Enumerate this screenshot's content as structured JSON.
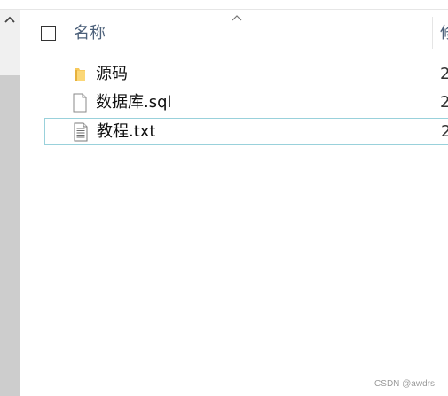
{
  "header": {
    "name_label": "名称",
    "next_column_label": "修"
  },
  "files": [
    {
      "name": "源码",
      "icon": "folder-icon",
      "date": "2"
    },
    {
      "name": "数据库.sql",
      "icon": "blank-file-icon",
      "date": "2"
    },
    {
      "name": "教程.txt",
      "icon": "text-file-icon",
      "date": "2",
      "selected": true
    }
  ],
  "watermark": "CSDN @awdrs",
  "colors": {
    "header_text": "#4c607a",
    "selection_border": "#99d1db",
    "folder_yellow": "#f7c95c",
    "scrollbar_thumb": "#cdcdcd"
  }
}
